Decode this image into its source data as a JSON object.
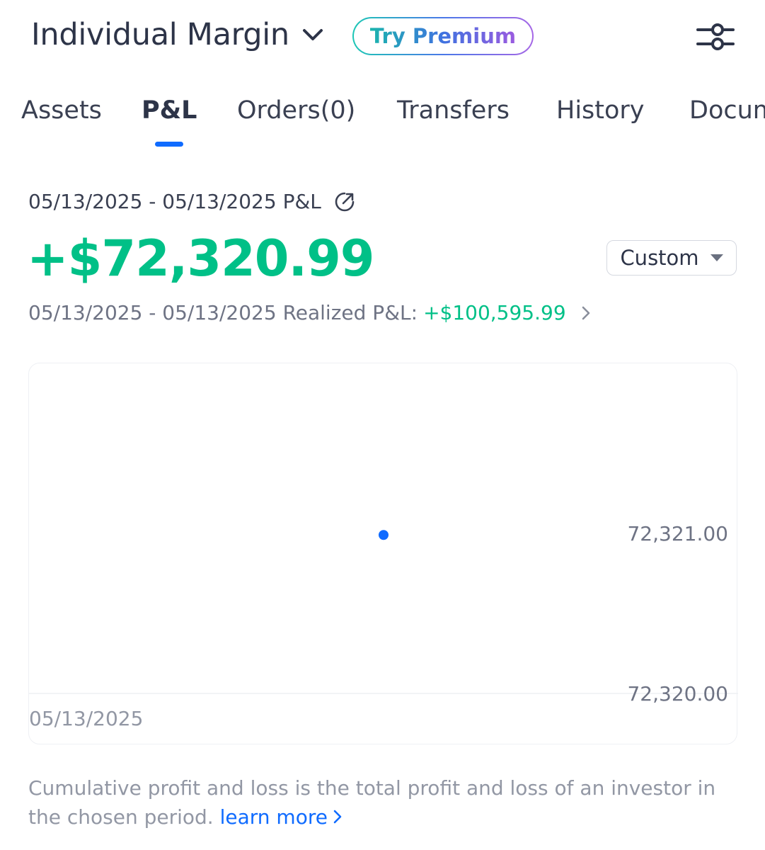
{
  "header": {
    "account_title": "Individual Margin",
    "premium_label": "Try Premium"
  },
  "tabs": [
    {
      "label": "Assets",
      "active": false
    },
    {
      "label": "P&L",
      "active": true
    },
    {
      "label": "Orders(0)",
      "active": false
    },
    {
      "label": "Transfers",
      "active": false
    },
    {
      "label": "History",
      "active": false
    },
    {
      "label": "Documents",
      "active": false
    }
  ],
  "summary": {
    "range_label": "05/13/2025 - 05/13/2025 P&L",
    "pnl_value": "+$72,320.99",
    "period_select": "Custom",
    "realized_label": "05/13/2025 - 05/13/2025 Realized P&L:",
    "realized_value": "+$100,595.99"
  },
  "chart_data": {
    "type": "scatter",
    "x": [
      "05/13/2025"
    ],
    "y": [
      72320.99
    ],
    "y_ticks": [
      "72,321.00",
      "72,320.00"
    ],
    "ylim": [
      72320.0,
      72321.0
    ],
    "x_tick_labels": [
      "05/13/2025"
    ],
    "point_color": "#0f6bff",
    "grid": false
  },
  "footnote": {
    "text": "Cumulative profit and loss is the total profit and loss of an investor in the chosen period. ",
    "link_label": "learn more"
  },
  "colors": {
    "positive": "#00c087",
    "accent": "#0f6bff",
    "text_primary": "#2d3448",
    "text_secondary": "#6e7384"
  }
}
